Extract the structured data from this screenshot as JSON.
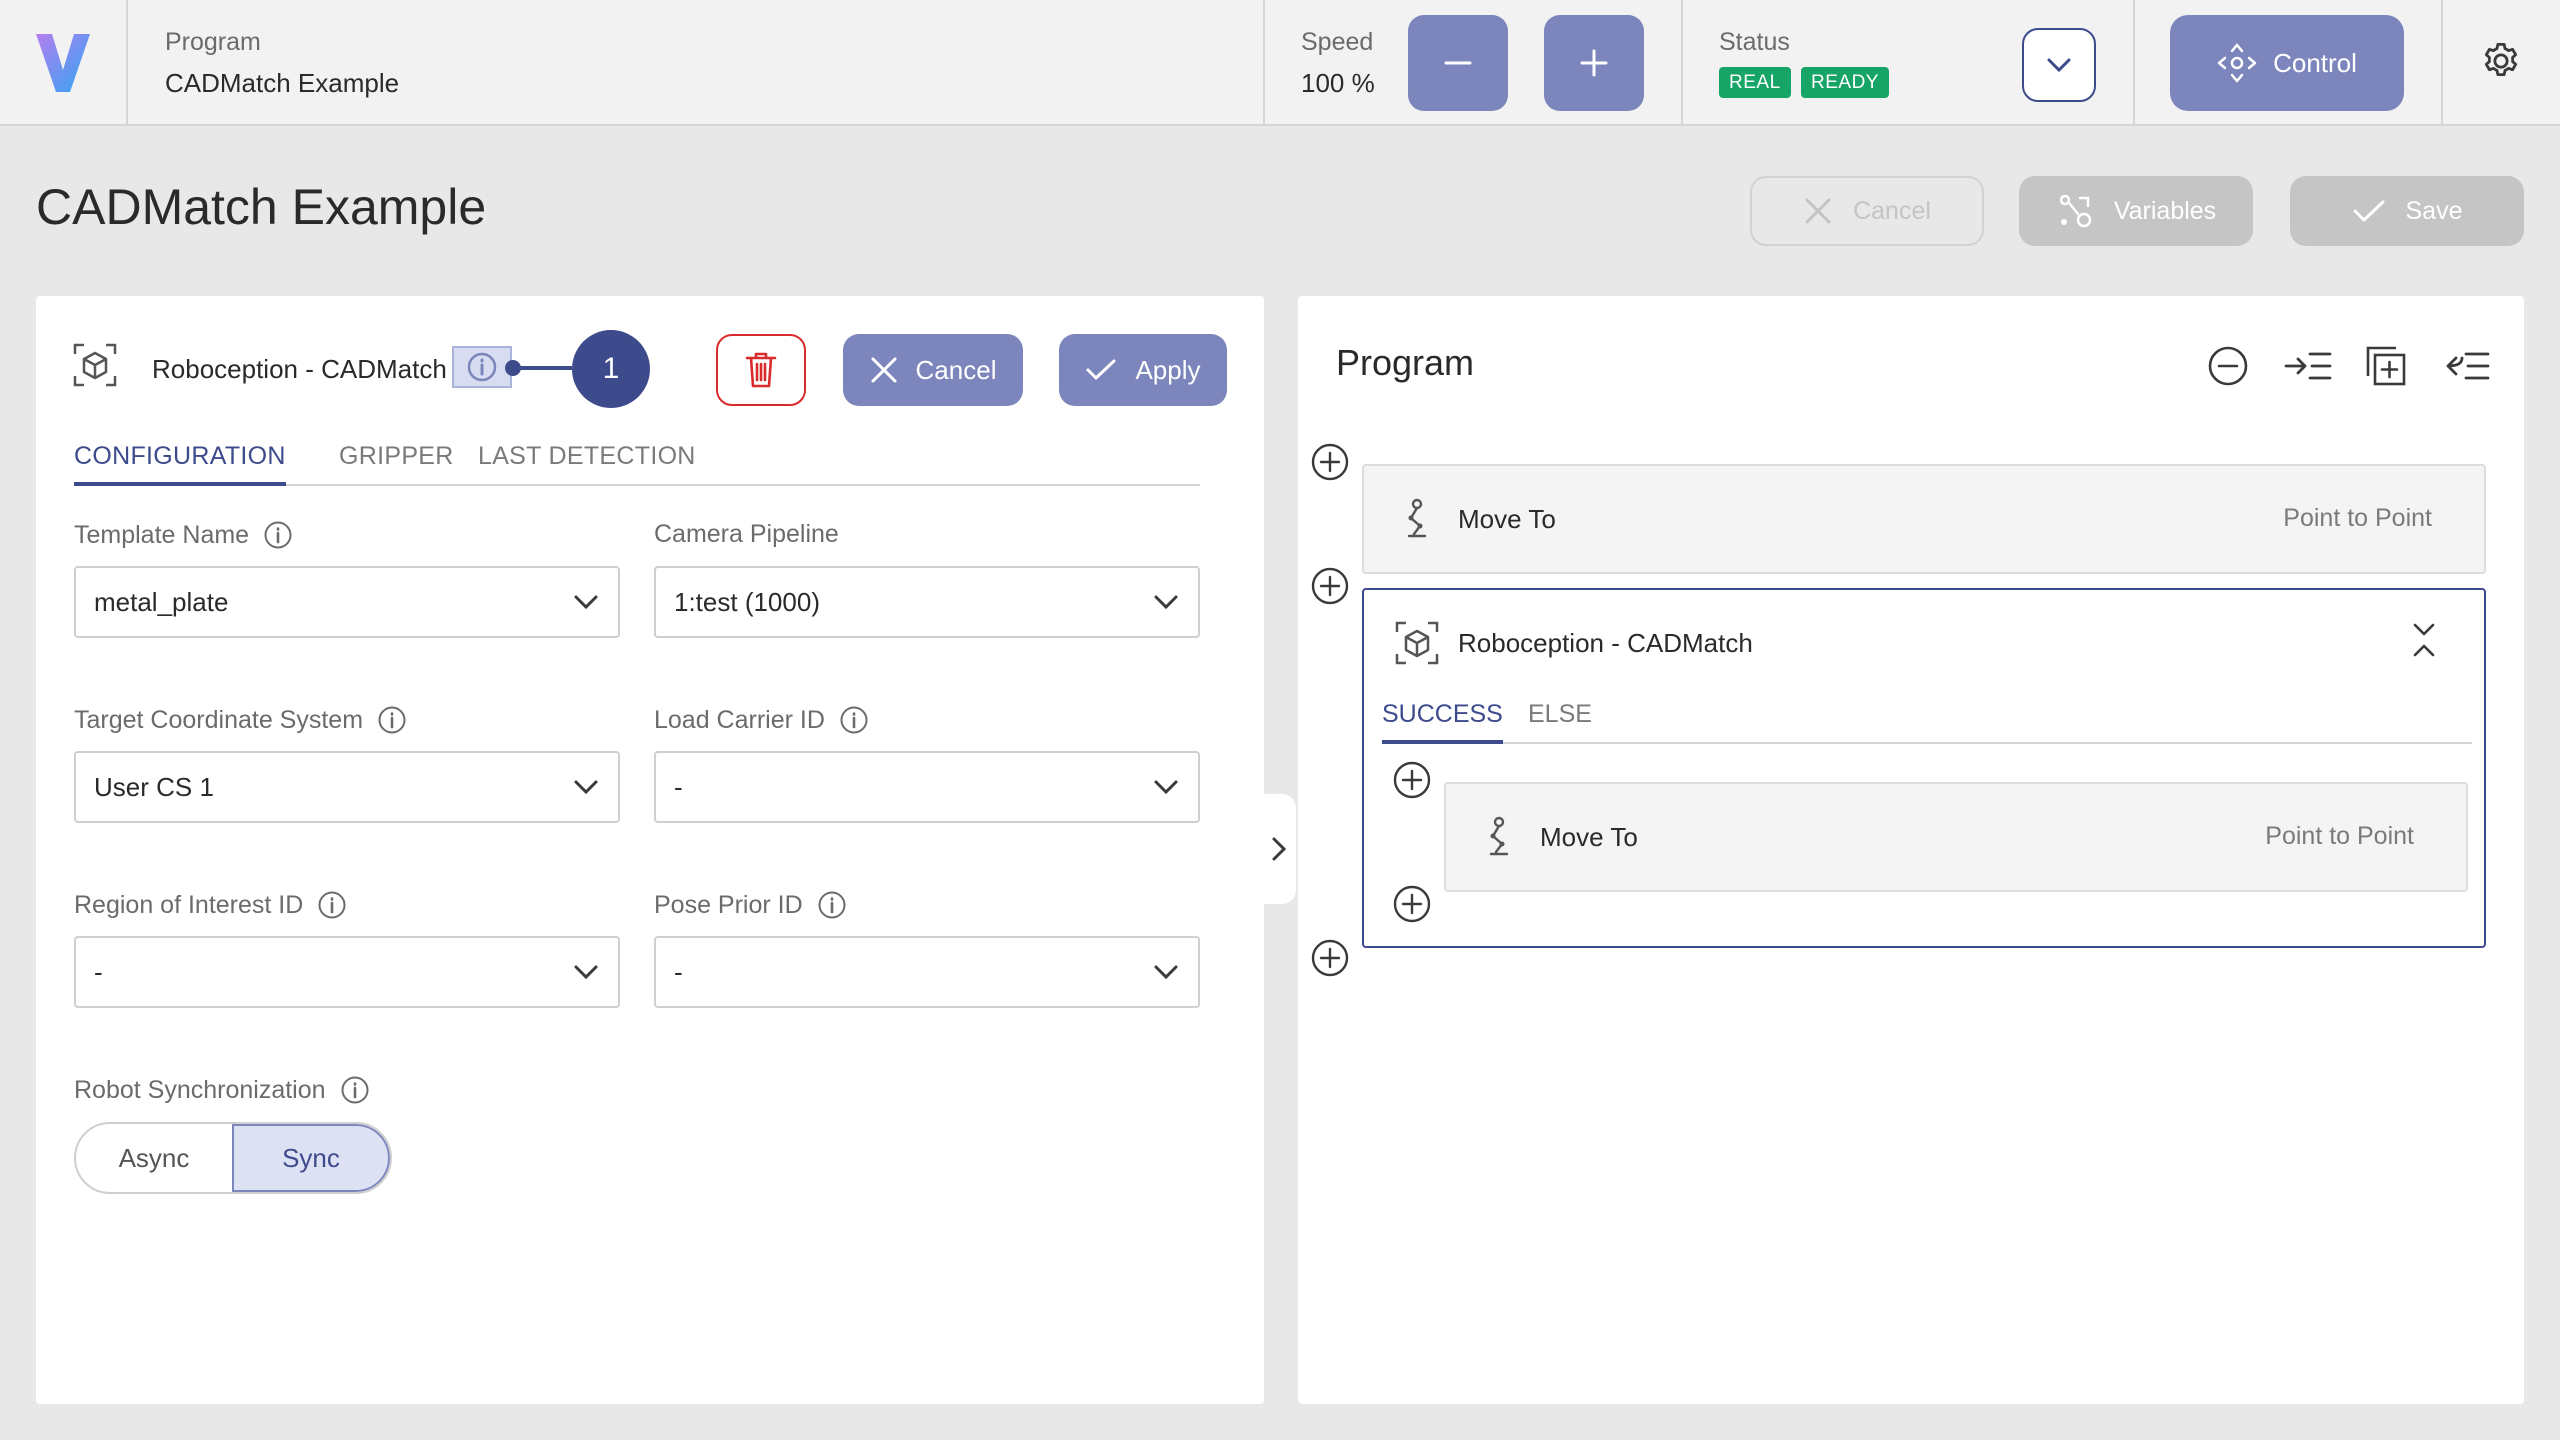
{
  "colors": {
    "accent": "#3d4a8c",
    "button": "#7c86bd",
    "status_green": "#16a566",
    "danger": "#d92b2b"
  },
  "topbar": {
    "program_label": "Program",
    "program_name": "CADMatch Example",
    "speed_label": "Speed",
    "speed_value": "100 %",
    "status_label": "Status",
    "badges": [
      "REAL",
      "READY"
    ],
    "control_label": "Control"
  },
  "page": {
    "title": "CADMatch Example",
    "cancel_label": "Cancel",
    "variables_label": "Variables",
    "save_label": "Save"
  },
  "node": {
    "title": "Roboception - CADMatch",
    "tour_step": "1",
    "cancel_label": "Cancel",
    "apply_label": "Apply",
    "tabs": [
      "CONFIGURATION",
      "GRIPPER",
      "LAST DETECTION"
    ],
    "active_tab": "CONFIGURATION"
  },
  "config": {
    "template_name": {
      "label": "Template Name",
      "value": "metal_plate"
    },
    "camera_pipeline": {
      "label": "Camera Pipeline",
      "value": "1:test (1000)"
    },
    "target_cs": {
      "label": "Target Coordinate System",
      "value": "User CS 1"
    },
    "load_carrier": {
      "label": "Load Carrier ID",
      "value": "-"
    },
    "roi": {
      "label": "Region of Interest ID",
      "value": "-"
    },
    "pose_prior": {
      "label": "Pose Prior ID",
      "value": "-"
    },
    "sync": {
      "label": "Robot Synchronization",
      "options": [
        "Async",
        "Sync"
      ],
      "selected": "Sync"
    }
  },
  "program": {
    "title": "Program",
    "blocks": [
      {
        "label": "Move To",
        "type": "Point to Point"
      }
    ],
    "cad_block": {
      "label": "Roboception - CADMatch",
      "tabs": [
        "SUCCESS",
        "ELSE"
      ],
      "active_tab": "SUCCESS",
      "children": [
        {
          "label": "Move To",
          "type": "Point to Point"
        }
      ]
    }
  },
  "icons": {
    "logo": "v-logo",
    "speed_down": "minus-icon",
    "speed_up": "plus-icon",
    "status_expand": "chevron-down-icon",
    "control": "move-arrows-icon",
    "settings": "gear-icon",
    "node": "cube-scan-icon",
    "info": "info-icon",
    "delete": "trash-icon",
    "move_to": "robot-arm-icon",
    "add": "plus-circle-icon"
  }
}
